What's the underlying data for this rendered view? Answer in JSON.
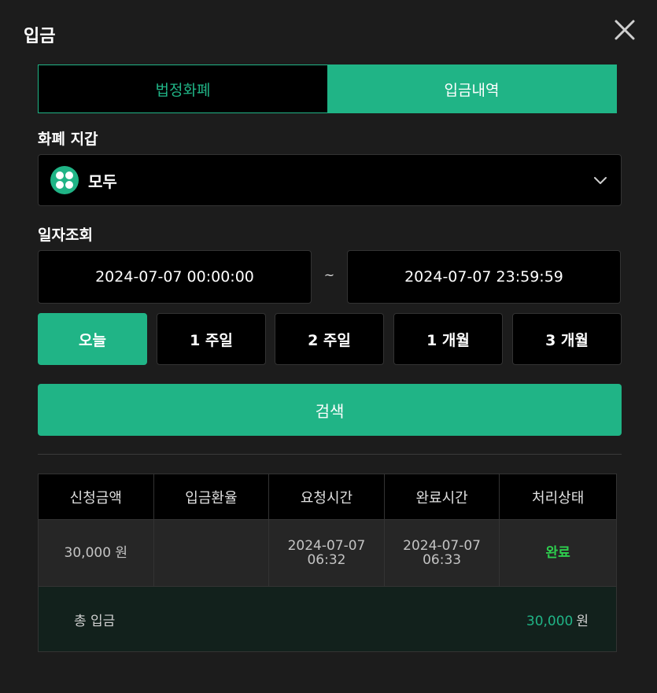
{
  "modal": {
    "title": "입금"
  },
  "tabs": [
    {
      "label": "법정화폐",
      "active": false
    },
    {
      "label": "입금내역",
      "active": true
    }
  ],
  "wallet": {
    "label": "화폐 지갑",
    "selected": "모두",
    "icon": "grid-icon"
  },
  "date_query": {
    "label": "일자조회",
    "start": "2024-07-07 00:00:00",
    "separator": "~",
    "end": "2024-07-07 23:59:59"
  },
  "quick_ranges": [
    {
      "label": "오늘",
      "active": true
    },
    {
      "label": "1 주일",
      "active": false
    },
    {
      "label": "2 주일",
      "active": false
    },
    {
      "label": "1 개월",
      "active": false
    },
    {
      "label": "3 개월",
      "active": false
    }
  ],
  "search": {
    "label": "검색"
  },
  "table": {
    "headers": [
      "신청금액",
      "입금환율",
      "요청시간",
      "완료시간",
      "처리상태"
    ],
    "rows": [
      {
        "amount": "30,000 원",
        "rate": "",
        "request_date": "2024-07-07",
        "request_time": "06:32",
        "complete_date": "2024-07-07",
        "complete_time": "06:33",
        "status": "완료"
      }
    ],
    "total": {
      "label": "총 입금",
      "amount": "30,000",
      "unit": "원"
    }
  },
  "colors": {
    "accent": "#20b486",
    "status_done": "#2ecf4e",
    "background": "#1c1c1c"
  }
}
